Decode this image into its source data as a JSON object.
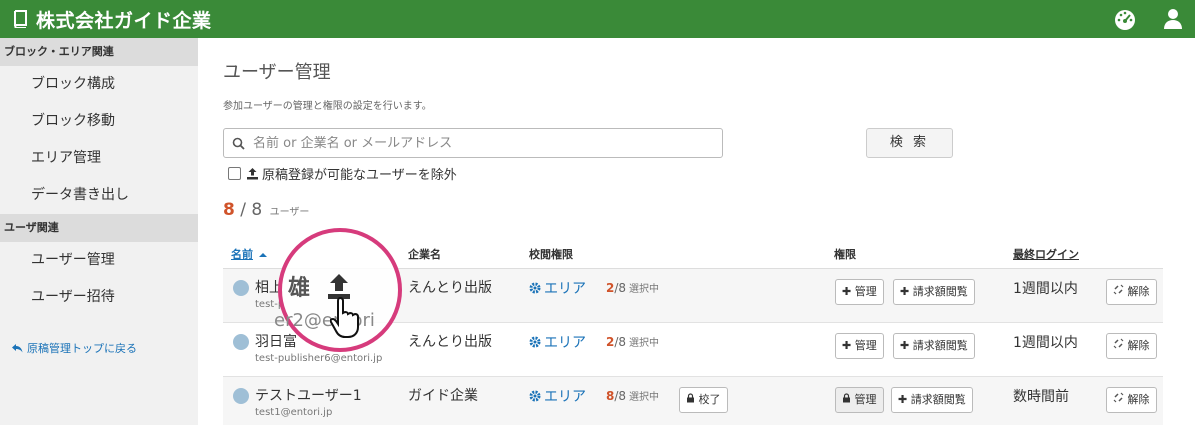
{
  "header": {
    "brand": "株式会社ガイド企業",
    "icons": [
      "dashboard-icon",
      "user-icon"
    ],
    "color": "#3a8a38"
  },
  "sidebar": {
    "sections": [
      {
        "title": "ブロック・エリア関連",
        "items": [
          "ブロック構成",
          "ブロック移動",
          "エリア管理",
          "データ書き出し"
        ]
      },
      {
        "title": "ユーザ関連",
        "items": [
          "ユーザー管理",
          "ユーザー招待"
        ]
      }
    ],
    "back_link": "原稿管理トップに戻る"
  },
  "main": {
    "title": "ユーザー管理",
    "description": "参加ユーザーの管理と権限の設定を行います。",
    "search": {
      "placeholder": "名前 or 企業名 or メールアドレス",
      "value": "",
      "button": "検 索"
    },
    "exclude_label": "原稿登録が可能なユーザーを除外",
    "count": {
      "current": "8",
      "separator": "/",
      "total": "8",
      "unit": "ユーザー"
    },
    "columns": {
      "name": "名前",
      "company": "企業名",
      "review": "校閲権限",
      "permission": "権限",
      "last_login": "最終ログイン"
    },
    "rows": [
      {
        "name": "相上",
        "email": "test-p",
        "company": "えんとり出版",
        "area": "エリア",
        "sel_count": "2",
        "sel_total": "/8",
        "sel_label": "選択中",
        "admin": "管理",
        "billing": "請求額閲覧",
        "last_login": "1週間以内",
        "release": "解除"
      },
      {
        "name": "羽日富",
        "email": "test-publisher6@entori.jp",
        "company": "えんとり出版",
        "area": "エリア",
        "sel_count": "2",
        "sel_total": "/8",
        "sel_label": "選択中",
        "admin": "管理",
        "billing": "請求額閲覧",
        "last_login": "1週間以内",
        "release": "解除"
      },
      {
        "name": "テストユーザー1",
        "email": "test1@entori.jp",
        "company": "ガイド企業",
        "area": "エリア",
        "sel_count": "8",
        "sel_total": "/8",
        "sel_label": "選択中",
        "proofread": "校了",
        "admin": "管理",
        "billing": "請求額閲覧",
        "last_login": "数時間前",
        "release": "解除"
      }
    ],
    "overlay": {
      "big_text": "雄",
      "ghost_text": "er2@entori",
      "color": "#d63b7c"
    }
  }
}
